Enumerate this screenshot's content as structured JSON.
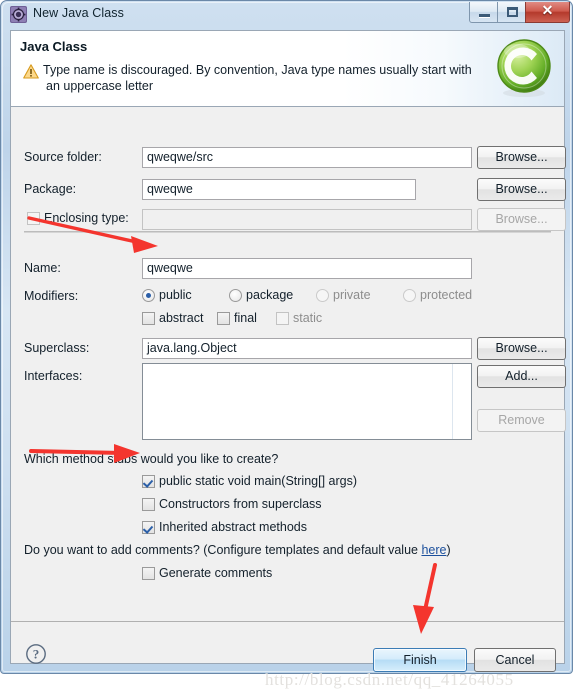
{
  "window": {
    "title": "New Java Class",
    "icon": "java-wizard-icon",
    "controls": {
      "minimize": "minimize-icon",
      "maximize": "maximize-icon",
      "close": "✕"
    }
  },
  "header": {
    "title": "Java Class",
    "status_icon": "warning-icon",
    "message_line1": "Type name is discouraged. By convention, Java type names usually start with",
    "message_line2": "an uppercase letter",
    "logo": "java-class-green-c-logo"
  },
  "form": {
    "source_folder": {
      "label": "Source folder:",
      "value": "qweqwe/src",
      "button": "Browse...",
      "enabled": true
    },
    "package": {
      "label": "Package:",
      "value": "qweqwe",
      "button": "Browse...",
      "enabled": true
    },
    "enclosing_type": {
      "label": "Enclosing type:",
      "value": "",
      "button": "Browse...",
      "checked": false,
      "enabled": false
    },
    "name": {
      "label": "Name:",
      "value": "qweqwe"
    },
    "modifiers": {
      "label": "Modifiers:",
      "radios": [
        {
          "label": "public",
          "selected": true,
          "enabled": true
        },
        {
          "label": "package",
          "selected": false,
          "enabled": true
        },
        {
          "label": "private",
          "selected": false,
          "enabled": false
        },
        {
          "label": "protected",
          "selected": false,
          "enabled": false
        }
      ],
      "checks": [
        {
          "label": "abstract",
          "checked": false,
          "enabled": true
        },
        {
          "label": "final",
          "checked": false,
          "enabled": true
        },
        {
          "label": "static",
          "checked": false,
          "enabled": false
        }
      ]
    },
    "superclass": {
      "label": "Superclass:",
      "value": "java.lang.Object",
      "button": "Browse..."
    },
    "interfaces": {
      "label": "Interfaces:",
      "items": [],
      "add_button": "Add...",
      "remove_button": "Remove",
      "remove_enabled": false
    }
  },
  "stubs": {
    "question": "Which method stubs would you like to create?",
    "options": [
      {
        "label": "public static void main(String[] args)",
        "checked": true
      },
      {
        "label": "Constructors from superclass",
        "checked": false
      },
      {
        "label": "Inherited abstract methods",
        "checked": true
      }
    ]
  },
  "comments": {
    "question_prefix": "Do you want to add comments? (Configure templates and default value ",
    "link": "here",
    "question_suffix": ")",
    "generate": {
      "label": "Generate comments",
      "checked": false
    }
  },
  "footer": {
    "help": "?",
    "finish": "Finish",
    "cancel": "Cancel"
  },
  "watermark": "http://blog.csdn.net/qq_41264055",
  "colors": {
    "accent": "#2b5fa8",
    "warning": "#f0ad4e",
    "link": "#1b4f9c",
    "close_red": "#b4392c",
    "arrow_red": "#f4352e",
    "logo_green": "#7cc340"
  }
}
